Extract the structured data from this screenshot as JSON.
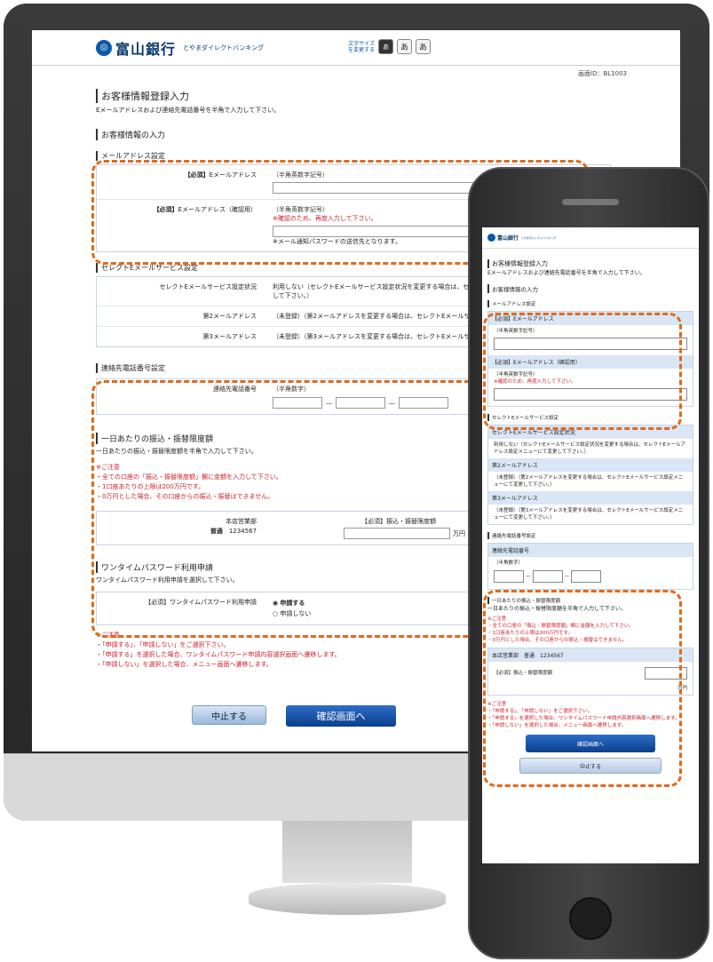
{
  "desktop": {
    "bank_name": "富山銀行",
    "service_name": "とやまダイレクトバンキング",
    "font_size_label": "文字サイズを変更する",
    "font_sizes": [
      "あ",
      "あ",
      "あ"
    ],
    "screen_id": "画面ID：BL1003",
    "page_title": "お客様情報登録入力",
    "page_lead": "Eメールアドレスおよび連絡先電話番号を半角で入力して下さい。",
    "input_heading": "お客様情報の入力",
    "mail_section": "メールアドレス設定",
    "email_required": "【必須】",
    "email_label": "Eメールアドレス",
    "email_hint": "（半角英数字記号）",
    "email_confirm_label": "Eメールアドレス（確認用）",
    "email_confirm_hint": "（半角英数字記号）",
    "email_confirm_warn": "※確認のため、再度入力して下さい。",
    "email_note": "※メール通知パスワードの送信先となります。",
    "select_mail_section": "セレクトEメールサービス設定",
    "select_mail_rows": [
      {
        "label": "セレクトEメールサービス設定状況",
        "value": "利用しない（セレクトEメールサービス設定状況を変更する場合は、セレクトEメールアドレス設定メニューにて変更して下さい。）"
      },
      {
        "label": "第2メールアドレス",
        "value": "（未登録）（第2メールアドレスを変更する場合は、セレクトEメールサービス設定メニューにて変更して下さい。）"
      },
      {
        "label": "第3メールアドレス",
        "value": "（未登録）（第3メールアドレスを変更する場合は、セレクトEメールサービス設定メニューにて変更して下さい。）"
      }
    ],
    "phone_section": "連絡先電話番号設定",
    "phone_label": "連絡先電話番号",
    "phone_hint": "（半角数字）",
    "limit_heading": "一日あたりの振込・振替限度額",
    "limit_lead": "一日あたりの振込・振替限度額を半角で入力して下さい。",
    "limit_caution_title": "※ご注意",
    "limit_cautions": [
      "・全ての口座の「振込・振替限度額」欄に金額を入力して下さい。",
      "・1口座あたりの上限は200万円です。",
      "・0万円とした場合、その口座からの振込・振替はできません。"
    ],
    "account_branch": "本店営業部",
    "account_type": "普通",
    "account_number": "1234567",
    "limit_label": "【必須】振込・振替限度額",
    "limit_unit": "万円",
    "otp_heading": "ワンタイムパスワード利用申請",
    "otp_lead": "ワンタイムパスワード利用申請を選択して下さい。",
    "otp_label": "【必須】ワンタイムパスワード利用申請",
    "otp_apply": "申請する",
    "otp_not_apply": "申請しない",
    "otp_caution_title": "※ご注意",
    "otp_cautions": [
      "・「申請する」、「申請しない」をご選択下さい。",
      "・「申請する」を選択した場合、ワンタイムパスワード申請内容選択画面へ遷移します。",
      "・「申請しない」を選択した場合、メニュー画面へ遷移します。"
    ],
    "cancel_button": "中止する",
    "confirm_button": "確認画面へ"
  },
  "mobile": {
    "bank_name": "富山銀行",
    "service_name": "とやまダイレクトバンキング",
    "page_title": "お客様情報登録入力",
    "page_lead": "Eメールアドレスおよび連絡先電話番号を半角で入力して下さい。",
    "input_heading": "お客様情報の入力",
    "mail_section": "メールアドレス設定",
    "email_band": "【必須】Eメールアドレス",
    "email_hint": "（半角英数字記号）",
    "email_confirm_band": "【必須】Eメールアドレス（確認用）",
    "email_confirm_hint": "（半角英数字記号）",
    "email_confirm_warn": "※確認のため、再度入力して下さい。",
    "select_mail_section": "セレクトEメールサービス設定",
    "select_status_band": "セレクトEメールサービス設定状況",
    "select_status_value": "利用しない（セレクトEメールサービス設定状況を変更する場合は、セレクトEメールアドレス設定メニューにて変更して下さい。）",
    "mail2_band": "第2メールアドレス",
    "mail2_value": "（未登録）（第2メールアドレスを変更する場合は、セレクトEメールサービス設定メニューにて変更して下さい。）",
    "mail3_band": "第3メールアドレス",
    "mail3_value": "（未登録）（第3メールアドレスを変更する場合は、セレクトEメールサービス設定メニューにて変更して下さい。）",
    "phone_section": "連絡先電話番号設定",
    "phone_band": "連絡先電話番号",
    "phone_hint": "（半角数字）",
    "limit_heading": "一日あたりの振込・振替限度額",
    "limit_lead": "一日あたりの振込・振替限度額を半角で入力して下さい。",
    "limit_caution_title": "※ご注意",
    "limit_cautions": [
      "・全ての口座の「振込・振替限度額」欄に金額を入力して下さい。",
      "・1口座あたりの上限は200万円です。",
      "・0万円とした場合、その口座からの振込・振替はできません。"
    ],
    "account_band": "本店営業部　普通　1234567",
    "limit_label": "【必須】振込・振替限度額",
    "limit_unit": "万円",
    "otp_caution_title": "※ご注意",
    "otp_cautions": [
      "・「申請する」、「申請しない」をご選択下さい。",
      "・「申請する」を選択した場合、ワンタイムパスワード申請内容選択画面へ遷移します。",
      "・「申請しない」を選択した場合、メニュー画面へ遷移します。"
    ],
    "confirm_button": "確認画面へ",
    "cancel_button": "中止する"
  },
  "colors": {
    "highlight": "#e06a1a",
    "brand": "#0b5aa8",
    "warning": "#d0202a"
  }
}
